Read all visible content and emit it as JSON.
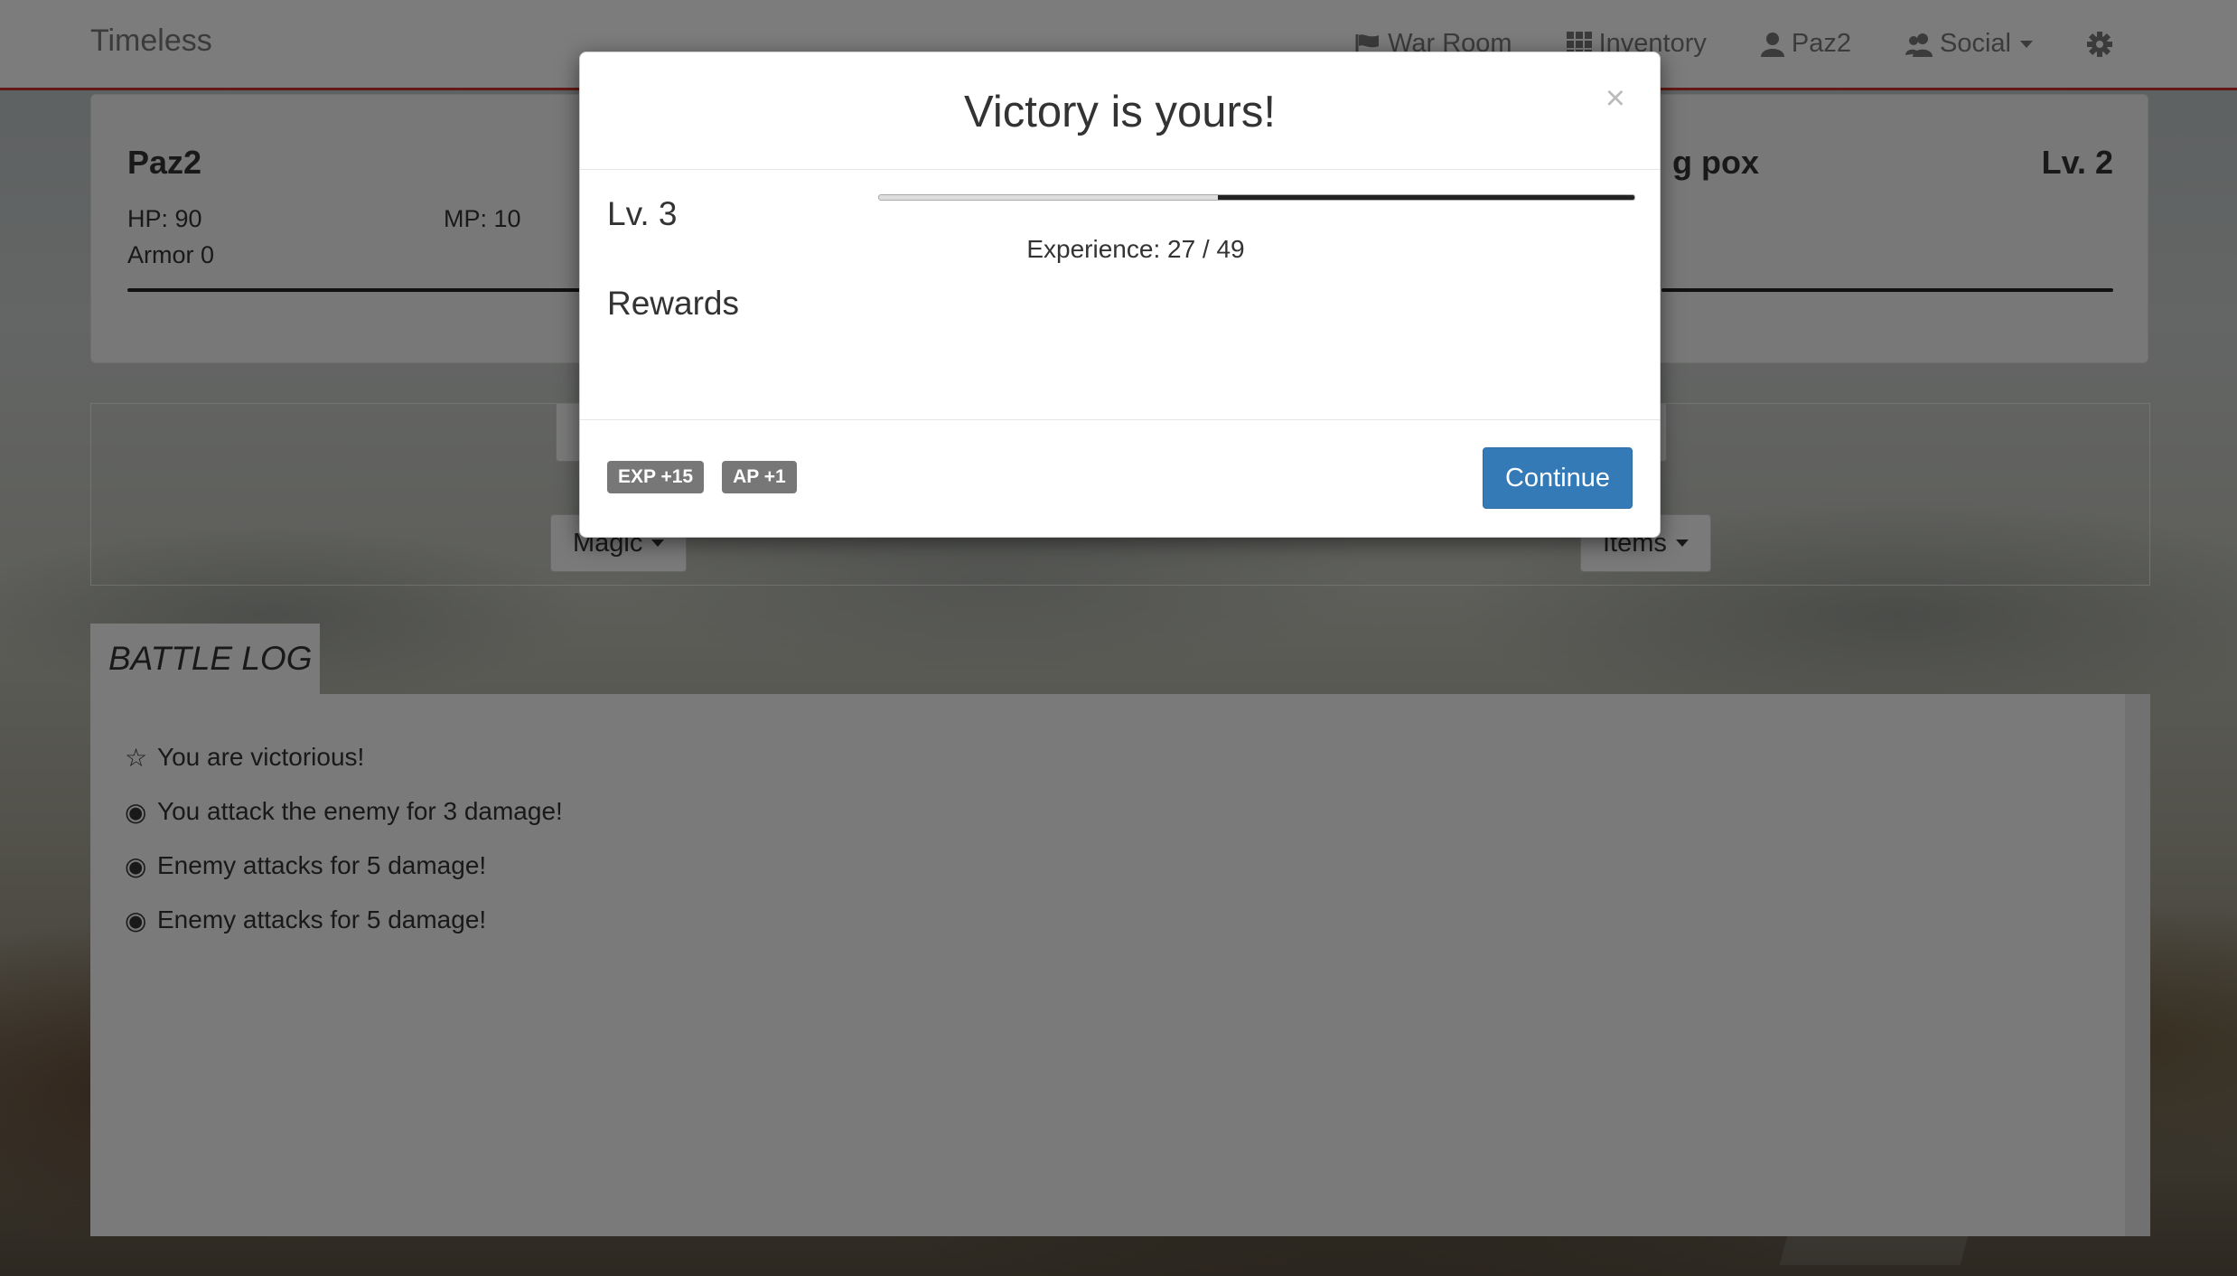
{
  "navbar": {
    "brand": "Timeless",
    "items": [
      {
        "label": "War Room",
        "icon": "flag-icon"
      },
      {
        "label": "Inventory",
        "icon": "grid-icon"
      },
      {
        "label": "Paz2",
        "icon": "user-icon"
      },
      {
        "label": "Social",
        "icon": "users-icon",
        "dropdown": true
      }
    ],
    "settings_icon": "gear-icon",
    "accent_color": "#c9302c"
  },
  "player": {
    "name": "Paz2",
    "hp": "HP: 90",
    "mp": "MP: 10",
    "armor": "Armor 0"
  },
  "enemy": {
    "name_partial": "g pox",
    "level": "Lv. 2"
  },
  "actions": {
    "magic": "Magic",
    "items": "Items"
  },
  "battle_log": {
    "title": "BATTLE LOG",
    "entries": [
      {
        "glyph": "☆",
        "text": "You are victorious!"
      },
      {
        "glyph": "◉",
        "text": "You attack the enemy for 3 damage!"
      },
      {
        "glyph": "◉",
        "text": "Enemy attacks for 5 damage!"
      },
      {
        "glyph": "◉",
        "text": "Enemy attacks for 5 damage!"
      }
    ]
  },
  "modal": {
    "title": "Victory is yours!",
    "close_glyph": "×",
    "level": "Lv. 3",
    "experience_text": "Experience: 27 / 49",
    "experience_current": 27,
    "experience_max": 49,
    "rewards_title": "Rewards",
    "rewards": [
      "EXP +15",
      "AP +1"
    ],
    "continue_label": "Continue",
    "button_color": "#337ab7"
  }
}
